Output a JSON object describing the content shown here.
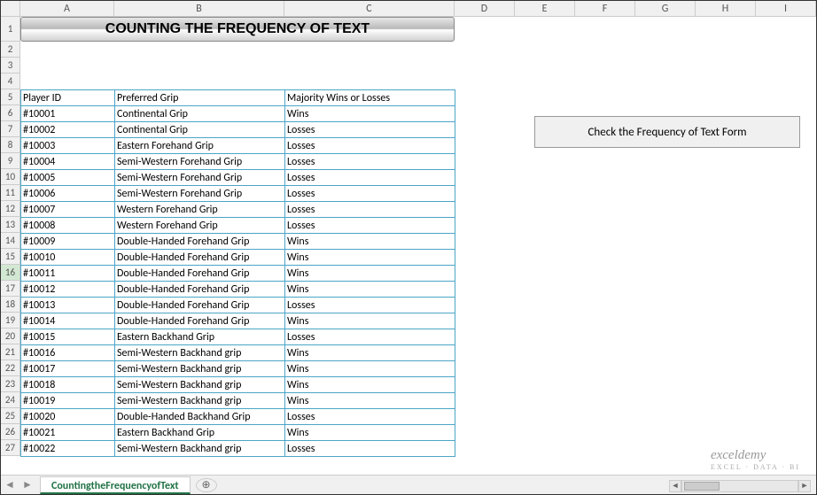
{
  "columns": [
    "A",
    "B",
    "C",
    "D",
    "E",
    "F",
    "G",
    "H",
    "I"
  ],
  "rowNumbers": [
    1,
    2,
    3,
    4,
    5,
    6,
    7,
    8,
    9,
    10,
    11,
    12,
    13,
    14,
    15,
    16,
    17,
    18,
    19,
    20,
    21,
    22,
    23,
    24,
    25,
    26,
    27
  ],
  "selectedRow": 16,
  "title": "COUNTING THE FREQUENCY OF TEXT",
  "button": {
    "label": "Check the Frequency of Text Form"
  },
  "headers": {
    "a": "Player ID",
    "b": "Preferred Grip",
    "c": "Majority Wins or Losses"
  },
  "rows": [
    {
      "a": "#10001",
      "b": "Continental Grip",
      "c": "Wins"
    },
    {
      "a": "#10002",
      "b": "Continental Grip",
      "c": "Losses"
    },
    {
      "a": "#10003",
      "b": "Eastern Forehand Grip",
      "c": "Losses"
    },
    {
      "a": "#10004",
      "b": "Semi-Western Forehand Grip",
      "c": "Losses"
    },
    {
      "a": "#10005",
      "b": "Semi-Western Forehand Grip",
      "c": "Losses"
    },
    {
      "a": "#10006",
      "b": "Semi-Western Forehand Grip",
      "c": "Losses"
    },
    {
      "a": "#10007",
      "b": "Western Forehand Grip",
      "c": "Losses"
    },
    {
      "a": "#10008",
      "b": "Western Forehand Grip",
      "c": "Losses"
    },
    {
      "a": "#10009",
      "b": "Double-Handed Forehand Grip",
      "c": "Wins"
    },
    {
      "a": "#10010",
      "b": "Double-Handed Forehand Grip",
      "c": "Wins"
    },
    {
      "a": "#10011",
      "b": "Double-Handed Forehand Grip",
      "c": "Wins"
    },
    {
      "a": "#10012",
      "b": "Double-Handed Forehand Grip",
      "c": "Wins"
    },
    {
      "a": "#10013",
      "b": "Double-Handed Forehand Grip",
      "c": "Losses"
    },
    {
      "a": "#10014",
      "b": "Double-Handed Forehand Grip",
      "c": "Wins"
    },
    {
      "a": "#10015",
      "b": "Eastern Backhand Grip",
      "c": "Losses"
    },
    {
      "a": "#10016",
      "b": "Semi-Western Backhand grip",
      "c": "Wins"
    },
    {
      "a": "#10017",
      "b": "Semi-Western Backhand grip",
      "c": "Wins"
    },
    {
      "a": "#10018",
      "b": "Semi-Western Backhand grip",
      "c": "Wins"
    },
    {
      "a": "#10019",
      "b": "Semi-Western Backhand grip",
      "c": "Wins"
    },
    {
      "a": "#10020",
      "b": "Double-Handed Backhand Grip",
      "c": "Losses"
    },
    {
      "a": "#10021",
      "b": "Eastern Backhand Grip",
      "c": "Wins"
    },
    {
      "a": "#10022",
      "b": "Semi-Western Backhand grip",
      "c": "Losses"
    }
  ],
  "sheet": {
    "name": "CountingtheFrequencyofText"
  },
  "watermark": {
    "brand": "exceldemy",
    "tag": "EXCEL · DATA · BI"
  },
  "icons": {
    "prev": "◄",
    "next": "►",
    "plus": "⊕",
    "left": "◄",
    "right": "►"
  }
}
